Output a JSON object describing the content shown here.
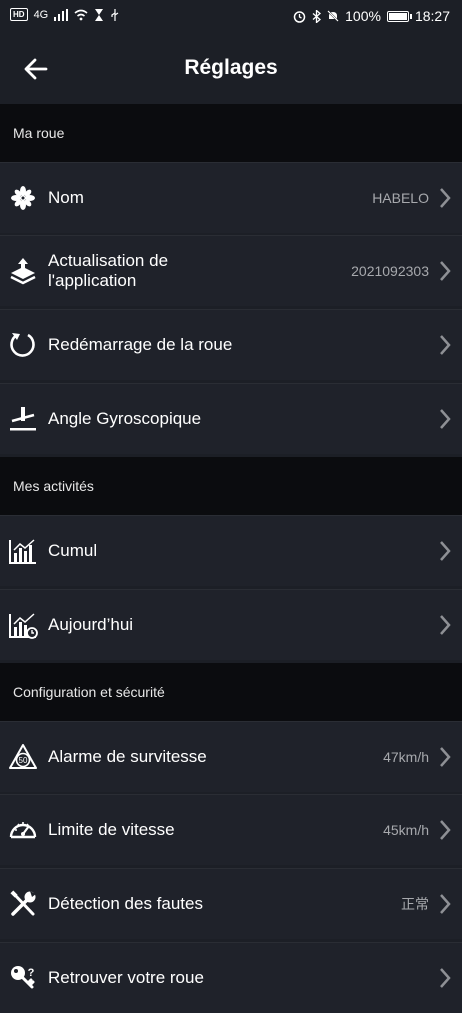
{
  "status": {
    "left_network": "4G",
    "battery": "100%",
    "battery_level": 1.0,
    "time": "18:27"
  },
  "header": {
    "title": "Réglages"
  },
  "sections": {
    "ma_roue": "Ma roue",
    "activites": "Mes activités",
    "config": "Configuration et sécurité"
  },
  "rows": [
    {
      "label": "Nom",
      "value": "HABELO",
      "icon": "fan-icon"
    },
    {
      "label": "Actualisation de l'application",
      "value": "2021092303",
      "icon": "layers-upload-icon"
    },
    {
      "label": "Redémarrage de la roue",
      "value": "",
      "icon": "restart-icon"
    },
    {
      "label": "Angle Gyroscopique",
      "value": "",
      "icon": "gyroscope-angle-icon"
    },
    {
      "label": "Cumul",
      "value": "",
      "icon": "bar-chart-icon"
    },
    {
      "label": "Aujourd’hui",
      "value": "",
      "icon": "bar-chart-clock-icon"
    },
    {
      "label": "Alarme de survitesse",
      "value": "47km/h",
      "icon": "speed-sign-50-icon"
    },
    {
      "label": "Limite de vitesse",
      "value": "45km/h",
      "icon": "speedometer-icon"
    },
    {
      "label": "Détection des fautes",
      "value": "正常",
      "icon": "wrench-tools-icon"
    },
    {
      "label": "Retrouver votre roue",
      "value": "",
      "icon": "key-question-icon"
    }
  ],
  "colors": {
    "background": "#1c1f26",
    "row": "#1f222a",
    "section": "#0b0c0f",
    "value_text": "#a7a9ad"
  }
}
